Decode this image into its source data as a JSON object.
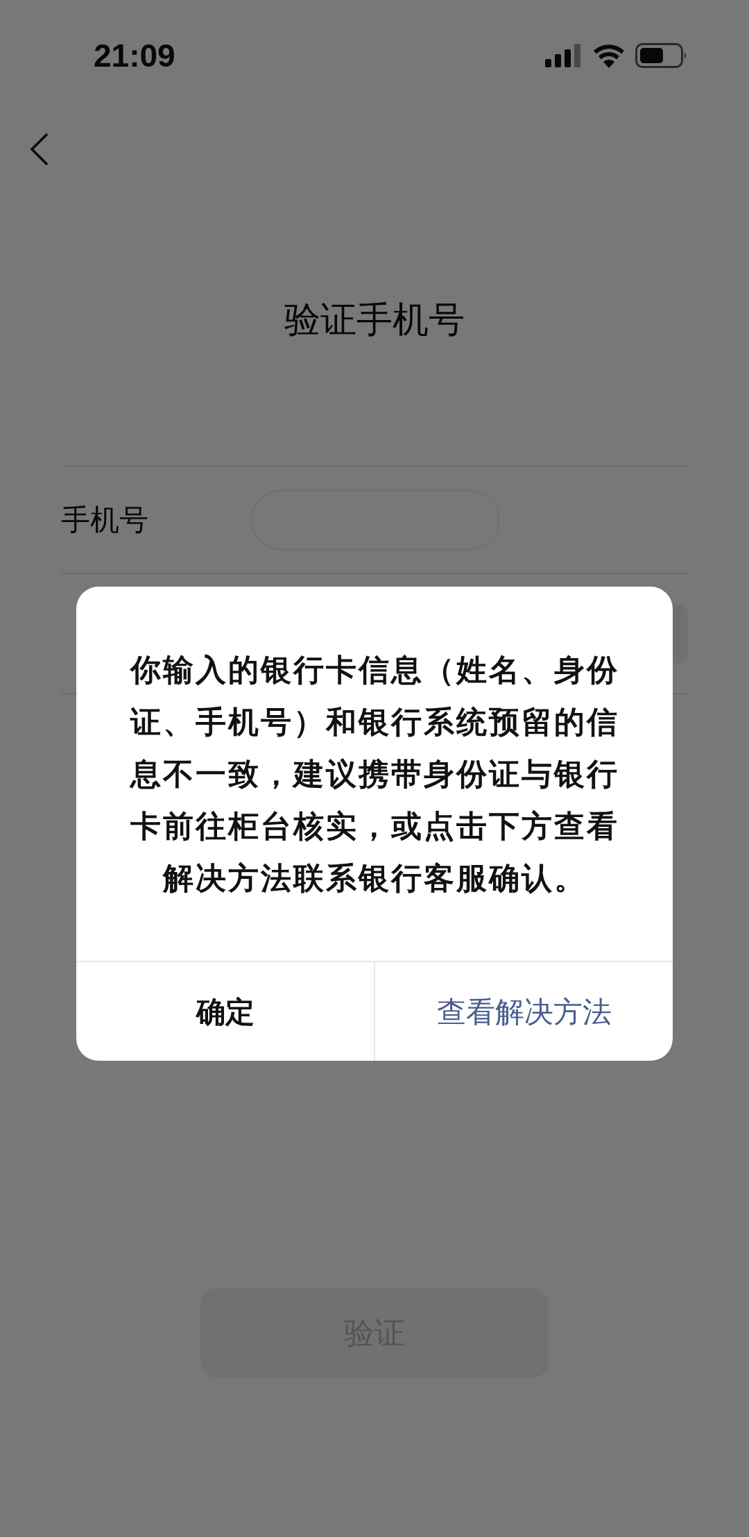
{
  "status_bar": {
    "time": "21:09"
  },
  "title": "验证手机号",
  "form": {
    "phone_label": "手机号"
  },
  "verify_button": {
    "label": "验证",
    "disabled": true
  },
  "dialog": {
    "message": "你输入的银行卡信息（姓名、身份证、手机号）和银行系统预留的信息不一致，建议携带身份证与银行卡前往柜台核实，或点击下方查看解决方法联系银行客服确认。",
    "buttons": [
      {
        "label": "确定",
        "kind": "default"
      },
      {
        "label": "查看解决方法",
        "kind": "primary"
      }
    ]
  }
}
